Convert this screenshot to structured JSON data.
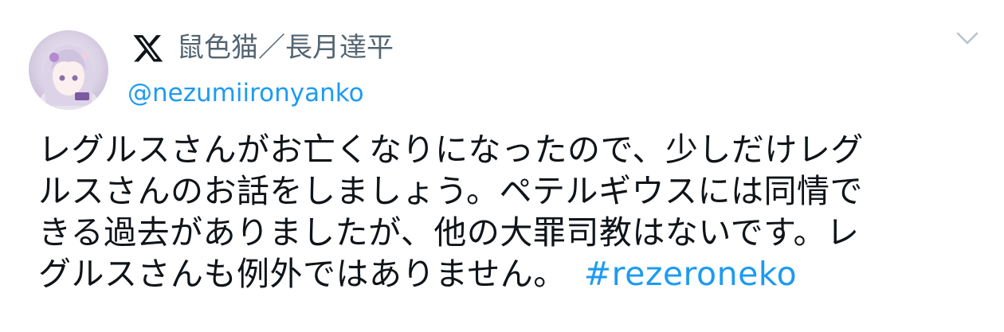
{
  "author": {
    "display_name": "鼠色猫／長月達平",
    "handle": "@nezumiironyanko",
    "avatar_icon": "anime-character-avatar",
    "platform_icon": "x-logo-icon"
  },
  "post": {
    "lines": [
      "レグルスさんがお亡くなりになったので、少しだけレグ",
      "ルスさんのお話をしましょう。ペテルギウスには同情で",
      "きる過去がありましたが、他の大罪司教はないです。レ",
      "グルスさんも例外ではありません。"
    ],
    "hashtag": "#rezeroneko"
  },
  "menu": {
    "icon": "chevron-down-icon"
  },
  "colors": {
    "text": "#0f1419",
    "secondary": "#536471",
    "link": "#1d9bf0"
  }
}
